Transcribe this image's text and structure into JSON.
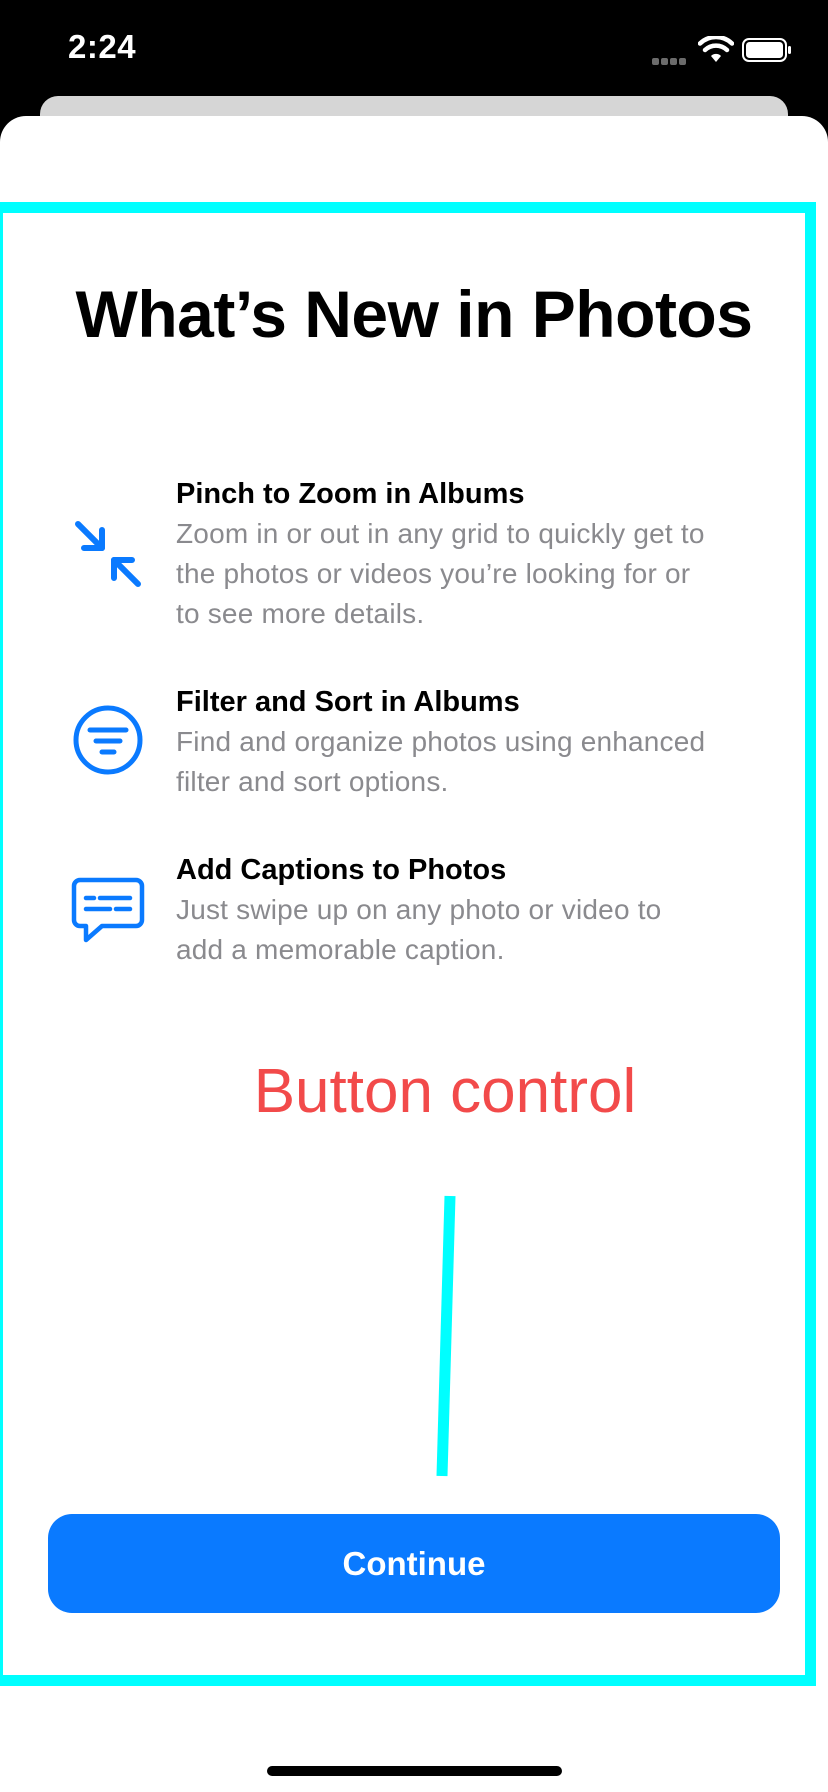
{
  "status_bar": {
    "time": "2:24",
    "icons": [
      "cellular-signal-icon",
      "wifi-icon",
      "battery-icon"
    ]
  },
  "sheet": {
    "title": "What’s New in Photos",
    "features": [
      {
        "icon": "pinch-zoom-arrows-icon",
        "title": "Pinch to Zoom in Albums",
        "lines": [
          "Zoom in or out in any grid to quickly get to",
          "the photos or videos you’re looking for or",
          "to see more details."
        ]
      },
      {
        "icon": "filter-sort-circle-icon",
        "title": "Filter and Sort in Albums",
        "lines": [
          "Find and organize photos using enhanced",
          "filter and sort options."
        ]
      },
      {
        "icon": "caption-bubble-icon",
        "title": "Add Captions to Photos",
        "lines": [
          "Just swipe up on any photo or video to",
          "add a memorable caption."
        ]
      }
    ],
    "continue_label": "Continue"
  },
  "annotation": {
    "label": "Button control",
    "label_color": "#f24a4a",
    "highlight_color": "#00ffff"
  },
  "colors": {
    "accent": "#0a7aff",
    "secondary_text": "#8a8a8e",
    "title_text": "#000000"
  }
}
